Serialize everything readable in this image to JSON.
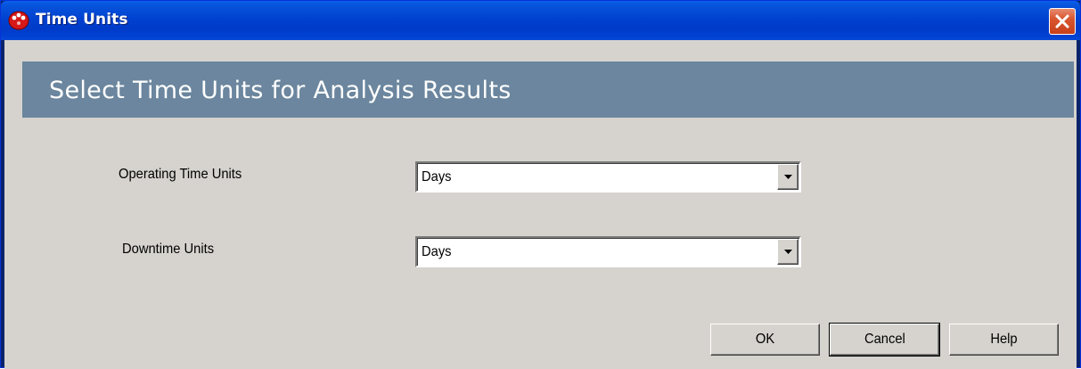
{
  "window": {
    "title": "Time Units"
  },
  "header": {
    "title": "Select Time Units for Analysis Results"
  },
  "fields": {
    "operating": {
      "label": "Operating Time Units",
      "value": "Days"
    },
    "downtime": {
      "label": "Downtime Units",
      "value": "Days"
    }
  },
  "buttons": {
    "ok": "OK",
    "cancel": "Cancel",
    "help": "Help"
  },
  "icons": {
    "app": "app-icon",
    "close": "close-icon",
    "dropdown": "chevron-down-icon"
  }
}
